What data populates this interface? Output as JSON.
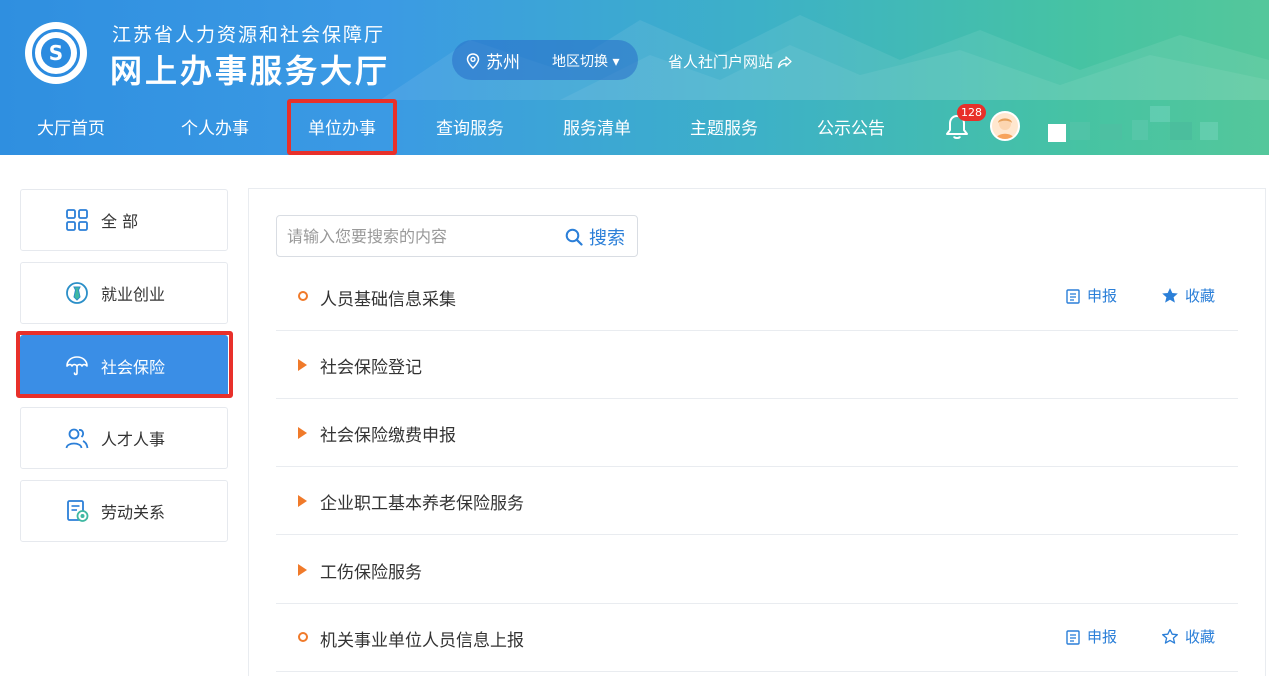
{
  "header": {
    "org_name": "江苏省人力资源和社会保障厅",
    "hall_name": "网上办事服务大厅",
    "city": "苏州",
    "region_switch": "地区切换 ▾",
    "portal_link": "省人社门户网站",
    "notification_count": "128"
  },
  "nav": {
    "items": [
      {
        "label": "大厅首页"
      },
      {
        "label": "个人办事"
      },
      {
        "label": "单位办事"
      },
      {
        "label": "查询服务"
      },
      {
        "label": "服务清单"
      },
      {
        "label": "主题服务"
      },
      {
        "label": "公示公告"
      }
    ],
    "active": "单位办事"
  },
  "sidebar": {
    "items": [
      {
        "label": "全 部",
        "icon": "grid-icon"
      },
      {
        "label": "就业创业",
        "icon": "tie-icon"
      },
      {
        "label": "社会保险",
        "icon": "umbrella-icon"
      },
      {
        "label": "人才人事",
        "icon": "people-icon"
      },
      {
        "label": "劳动关系",
        "icon": "contract-icon"
      }
    ],
    "active": "社会保险"
  },
  "search": {
    "placeholder": "请输入您要搜索的内容",
    "button": "搜索"
  },
  "list": {
    "items": [
      {
        "label": "人员基础信息采集",
        "marker": "dot",
        "report": "申报",
        "favorite": "收藏",
        "favorited": true
      },
      {
        "label": "社会保险登记",
        "marker": "triangle"
      },
      {
        "label": "社会保险缴费申报",
        "marker": "triangle"
      },
      {
        "label": "企业职工基本养老保险服务",
        "marker": "triangle"
      },
      {
        "label": "工伤保险服务",
        "marker": "triangle"
      },
      {
        "label": "机关事业单位人员信息上报",
        "marker": "dot",
        "report": "申报",
        "favorite": "收藏",
        "favorited": false
      }
    ]
  },
  "colors": {
    "accent": "#3a8ee6",
    "highlight_box": "#e8302a",
    "marker": "#f07a2a",
    "link": "#2b7fd8"
  }
}
